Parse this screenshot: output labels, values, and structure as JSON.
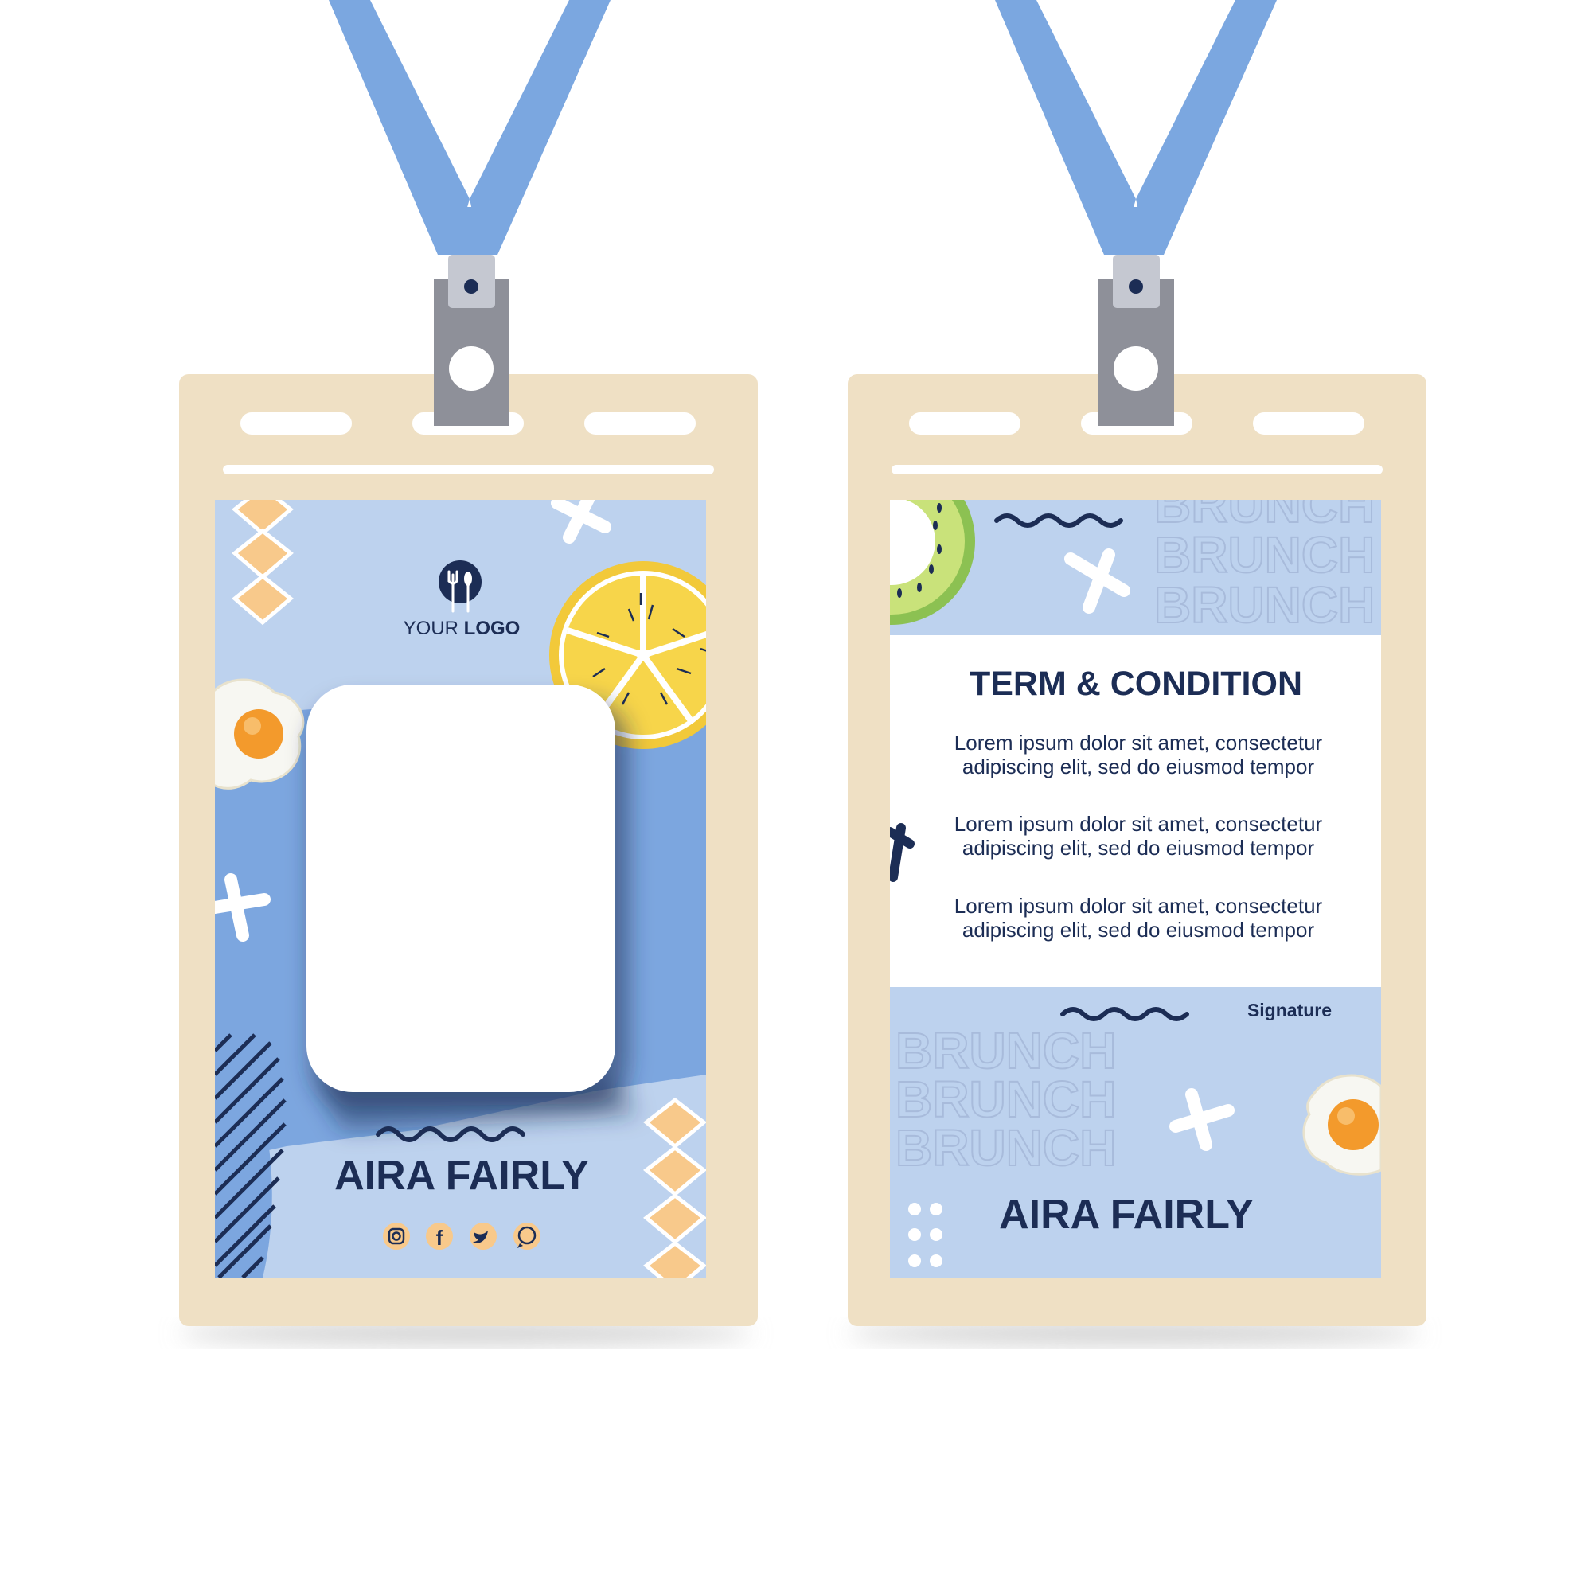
{
  "colors": {
    "lanyard": "#7ba7e0",
    "clip_light": "#c5c8d1",
    "clip_dark": "#8e9099",
    "holder": "#efe0c4",
    "panel_light": "#bdd2ee",
    "panel_mid": "#7ca6df",
    "navy": "#1c2d55",
    "lemon": "#f2c93a",
    "kiwi": "#8cc152",
    "egg_yolk": "#f39a2c",
    "chevron": "#f8c98b"
  },
  "front": {
    "logo_icon": "fork-spoon-icon",
    "logo_text_light": "YOUR",
    "logo_text_bold": "LOGO",
    "name": "AIRA FAIRLY",
    "social_icons": [
      "instagram-icon",
      "facebook-icon",
      "twitter-icon",
      "whatsapp-icon"
    ]
  },
  "back": {
    "brunch_words": [
      "BRUNCH",
      "BRUNCH",
      "BRUNCH"
    ],
    "title": "TERM & CONDITION",
    "terms": [
      {
        "line1": "Lorem ipsum dolor sit amet, consectetur",
        "line2": "adipiscing elit, sed do eiusmod tempor"
      },
      {
        "line1": "Lorem ipsum dolor sit amet, consectetur",
        "line2": "adipiscing elit, sed do eiusmod tempor"
      },
      {
        "line1": "Lorem ipsum dolor sit amet, consectetur",
        "line2": "adipiscing elit, sed do eiusmod tempor"
      }
    ],
    "signature_label": "Signature",
    "name": "AIRA FAIRLY"
  }
}
